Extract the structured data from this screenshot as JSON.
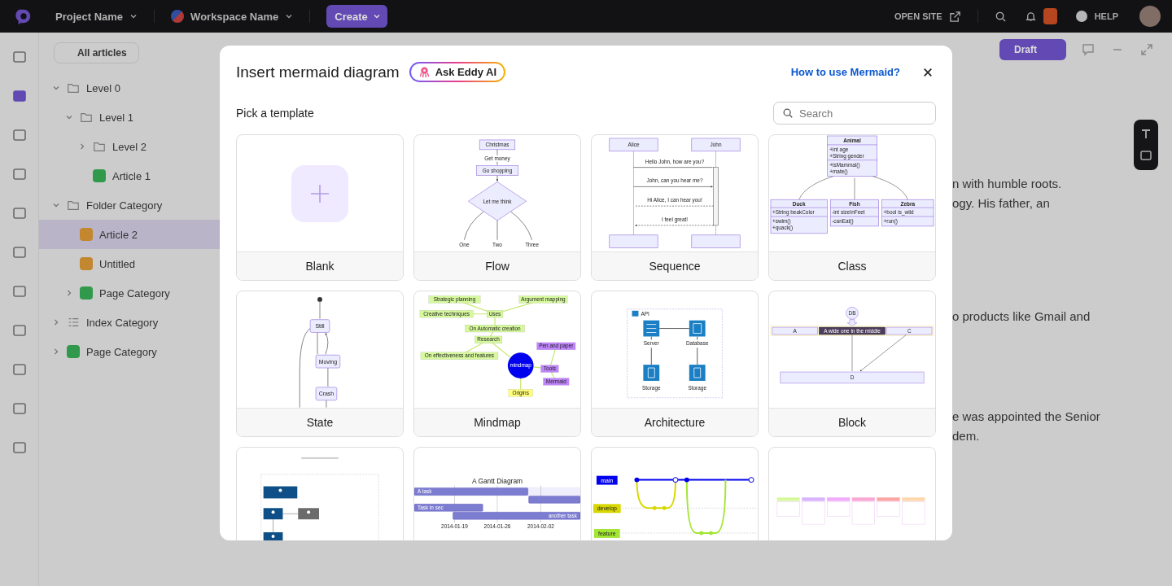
{
  "topbar": {
    "project": "Project Name",
    "workspace": "Workspace Name",
    "create": "Create",
    "open_site": "OPEN SITE",
    "help": "HELP"
  },
  "nav_rail": [
    {
      "selected": false
    },
    {
      "selected": true
    },
    {
      "selected": false
    },
    {
      "selected": false
    },
    {
      "selected": false
    },
    {
      "selected": false
    },
    {
      "selected": false
    },
    {
      "selected": false
    },
    {
      "selected": false
    },
    {
      "selected": false
    },
    {
      "selected": false
    }
  ],
  "sidebar": {
    "filter": "All articles",
    "tree": [
      {
        "label": "Level 0",
        "kind": "folder",
        "expanded": true,
        "selected": false,
        "children": [
          {
            "label": "Level 1",
            "kind": "folder",
            "expanded": true,
            "selected": false,
            "children": [
              {
                "label": "Level 2",
                "kind": "folder",
                "expanded": false,
                "selected": false
              },
              {
                "label": "Article 1",
                "kind": "article",
                "color": "#30994b",
                "selected": false
              }
            ]
          }
        ]
      },
      {
        "label": "Folder Category",
        "kind": "folder",
        "expanded": true,
        "selected": false,
        "children": [
          {
            "label": "Article 2",
            "kind": "article",
            "color": "#c2872f",
            "selected": true
          },
          {
            "label": "Untitled",
            "kind": "article",
            "color": "#c2872f",
            "selected": false
          },
          {
            "label": "Page Category",
            "kind": "article",
            "color": "#30994b",
            "expanded": false,
            "selected": false
          }
        ]
      },
      {
        "label": "Index Category",
        "kind": "index",
        "expanded": false,
        "selected": false
      },
      {
        "label": "Page Category",
        "kind": "article",
        "color": "#30994b",
        "expanded": false,
        "selected": false
      }
    ]
  },
  "editor": {
    "status": "Draft",
    "paragraphs": [
      {
        "lines": [
          "n with humble roots.",
          "ogy. His father, an"
        ]
      },
      {
        "lines": [
          "o products like Gmail and"
        ]
      },
      {
        "lines": [
          "e was appointed the Senior",
          "dem."
        ]
      }
    ]
  },
  "modal": {
    "title": "Insert mermaid diagram",
    "ai_button": "Ask Eddy AI",
    "help_link": "How to use Mermaid?",
    "subtitle": "Pick a template",
    "search": {
      "placeholder": "Search"
    },
    "templates": [
      {
        "label": "Blank",
        "kind": "blank"
      },
      {
        "label": "Flow",
        "kind": "flow",
        "labels": [
          "Christmas",
          "Get money",
          "Go shopping",
          "Let me think",
          "One",
          "Two",
          "Three"
        ]
      },
      {
        "label": "Sequence",
        "kind": "sequence",
        "labels": [
          "Alice",
          "John",
          "Hello John, how are you?",
          "John, can you hear me?",
          "Hi Alice, I can hear you!",
          "I feel great!"
        ]
      },
      {
        "label": "Class",
        "kind": "class",
        "labels": [
          "Animal",
          "+int age",
          "+String gender",
          "+isMammal()",
          "+mate()",
          "Duck",
          "+String beakColor",
          "+swim()",
          "+quack()",
          "Fish",
          "-int sizeInFeet",
          "-canEat()",
          "Zebra",
          "+bool is_wild",
          "+run()"
        ]
      },
      {
        "label": "State",
        "kind": "state",
        "labels": [
          "Still",
          "Moving",
          "Crash"
        ]
      },
      {
        "label": "Mindmap",
        "kind": "mindmap",
        "labels": [
          "Strategic planning",
          "Argument mapping",
          "Creative techniques",
          "Uses",
          "On Automatic creation",
          "Research",
          "On effectiveness and features",
          "Pen and paper",
          "mindmap",
          "Tools",
          "Mermaid",
          "Origins"
        ]
      },
      {
        "label": "Architecture",
        "kind": "architecture",
        "labels": [
          "API",
          "Server",
          "Database",
          "Storage",
          "Storage"
        ]
      },
      {
        "label": "Block",
        "kind": "block",
        "labels": [
          "DB",
          "A",
          "A wide one in the middle",
          "C",
          "D"
        ]
      },
      {
        "kind": "c4"
      },
      {
        "kind": "gantt",
        "labels": [
          "A Gantt Diagram",
          "A task",
          "Task in sec",
          "another task",
          "2014-01-19",
          "2014-01-26",
          "2014-02-02"
        ]
      },
      {
        "kind": "git",
        "labels": [
          "main",
          "develop",
          "feature"
        ]
      },
      {
        "kind": "kanban"
      }
    ]
  }
}
